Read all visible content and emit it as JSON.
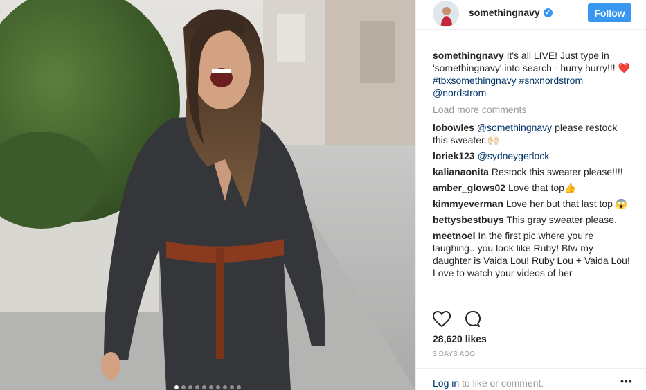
{
  "header": {
    "username": "somethingnavy",
    "follow_label": "Follow",
    "verified_icon": "verified-badge-icon"
  },
  "caption": {
    "username": "somethingnavy",
    "text_1": "It's all LIVE! Just type in 'somethingnavy' into search - hurry hurry!!!",
    "emoji": "❤️",
    "tag_1": "#tbxsomethingnavy",
    "tag_2": "#snxnordstrom",
    "mention": "@nordstrom"
  },
  "load_more": "Load more comments",
  "comments": [
    {
      "username": "lobowles",
      "mention": "@somethingnavy",
      "text": "please restock this sweater 🙌🏻"
    },
    {
      "username": "loriek123",
      "mention": "@sydneygerlock",
      "text": ""
    },
    {
      "username": "kalianaonita",
      "mention": "",
      "text": "Restock this sweater please!!!!"
    },
    {
      "username": "amber_glows02",
      "mention": "",
      "text": "Love that top👍"
    },
    {
      "username": "kimmyeverman",
      "mention": "",
      "text": "Love her but that last top 😱"
    },
    {
      "username": "bettysbestbuys",
      "mention": "",
      "text": "This gray sweater please."
    },
    {
      "username": "meetnoel",
      "mention": "",
      "text": "In the first pic where you're laughing.. you look like Ruby! Btw my daughter is Vaida Lou! Ruby Lou + Vaida Lou! Love to watch your videos of her"
    }
  ],
  "likes": "28,620 likes",
  "timestamp": "3 DAYS AGO",
  "login": {
    "link": "Log in",
    "text": "to like or comment."
  },
  "more_label": "•••",
  "colors": {
    "accent": "#3897f0",
    "link": "#003569",
    "muted": "#999999",
    "text": "#262626"
  }
}
